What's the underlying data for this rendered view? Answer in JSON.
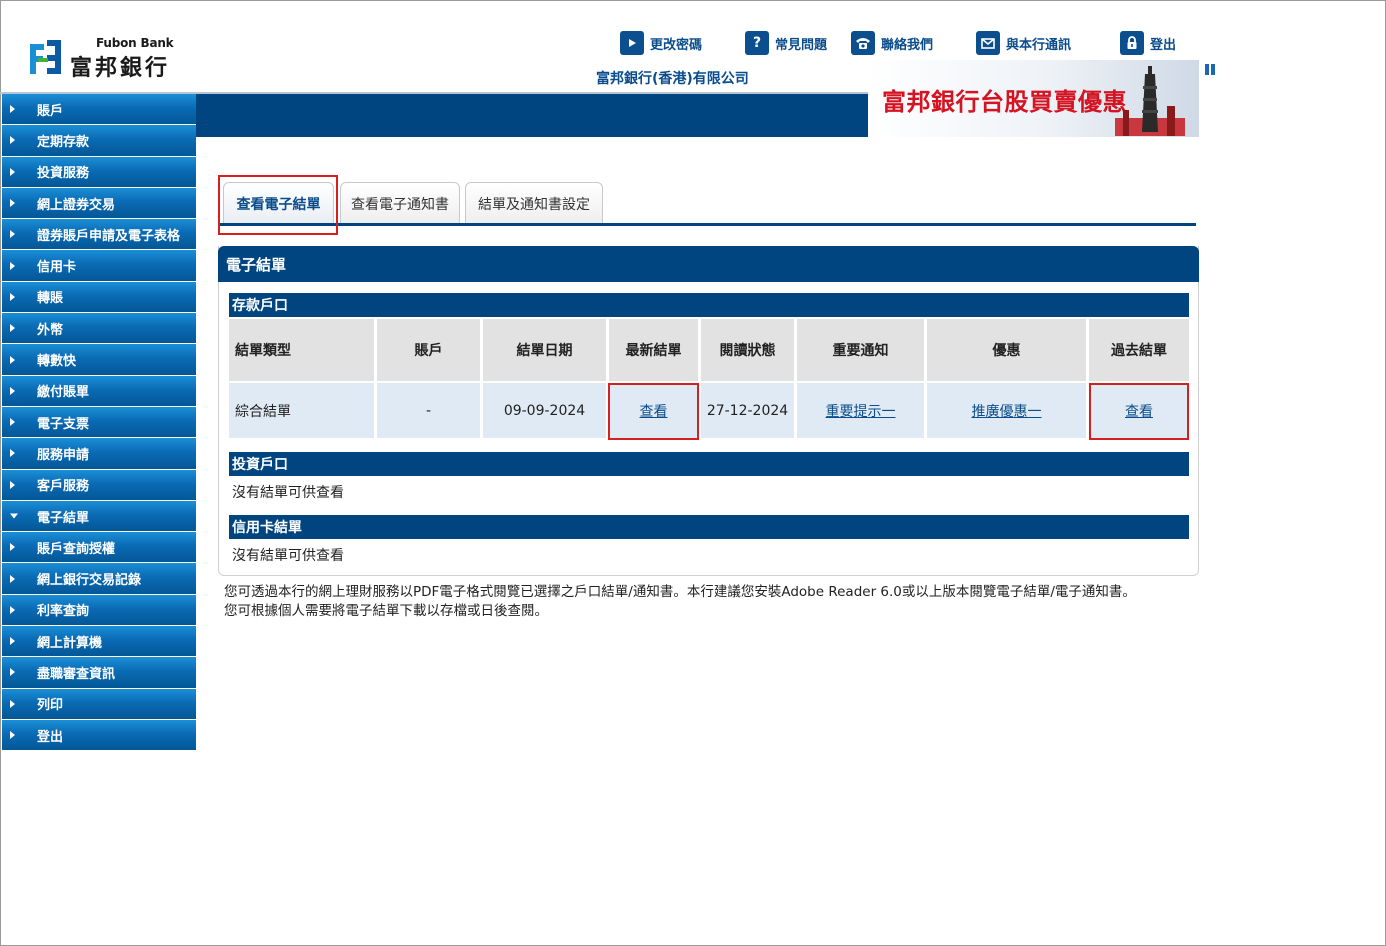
{
  "brand": {
    "name_en": "Fubon Bank",
    "name_zh": "富邦銀行"
  },
  "company": "富邦銀行(香港)有限公司",
  "topnav": [
    {
      "label": "更改密碼",
      "icon": "play-icon"
    },
    {
      "label": "常見問題",
      "icon": "question-icon"
    },
    {
      "label": "聯絡我們",
      "icon": "phone-icon"
    },
    {
      "label": "與本行通訊",
      "icon": "mail-icon"
    },
    {
      "label": "登出",
      "icon": "lock-icon"
    }
  ],
  "ad": {
    "text": "富邦銀行台股買賣優惠"
  },
  "sidebar": {
    "items": [
      "賬戶",
      "定期存款",
      "投資服務",
      "網上證券交易",
      "證券賬戶申請及電子表格",
      "信用卡",
      "轉賬",
      "外幣",
      "轉數快",
      "繳付賬單",
      "電子支票",
      "服務申請",
      "客戶服務",
      "電子結單",
      "賬戶查詢授權",
      "網上銀行交易記錄",
      "利率查詢",
      "網上計算機",
      "盡職審查資訊",
      "列印",
      "登出"
    ],
    "expanded_index": 13
  },
  "tabs": [
    "查看電子結單",
    "查看電子通知書",
    "結單及通知書設定"
  ],
  "panel": {
    "title": "電子結單",
    "deposit": {
      "title": "存款戶口",
      "columns": [
        "結單類型",
        "賬戶",
        "結單日期",
        "最新結單",
        "閱讀狀態",
        "重要通知",
        "優惠",
        "過去結單"
      ],
      "row": {
        "type": "綜合結單",
        "account": "-",
        "date": "09-09-2024",
        "latest": "查看",
        "read_status": "27-12-2024",
        "notice": "重要提示一",
        "offer": "推廣優惠一",
        "past": "查看"
      }
    },
    "investment": {
      "title": "投資戶口",
      "empty": "沒有結單可供查看"
    },
    "credit_card": {
      "title": "信用卡結單",
      "empty": "沒有結單可供查看"
    }
  },
  "footnote": {
    "line1": "您可透過本行的網上理財服務以PDF電子格式閱覽已選擇之戶口結單/通知書。本行建議您安裝Adobe Reader 6.0或以上版本閱覽電子結單/電子通知書。",
    "line2": "您可根據個人需要將電子結單下載以存檔或日後查閱。"
  }
}
